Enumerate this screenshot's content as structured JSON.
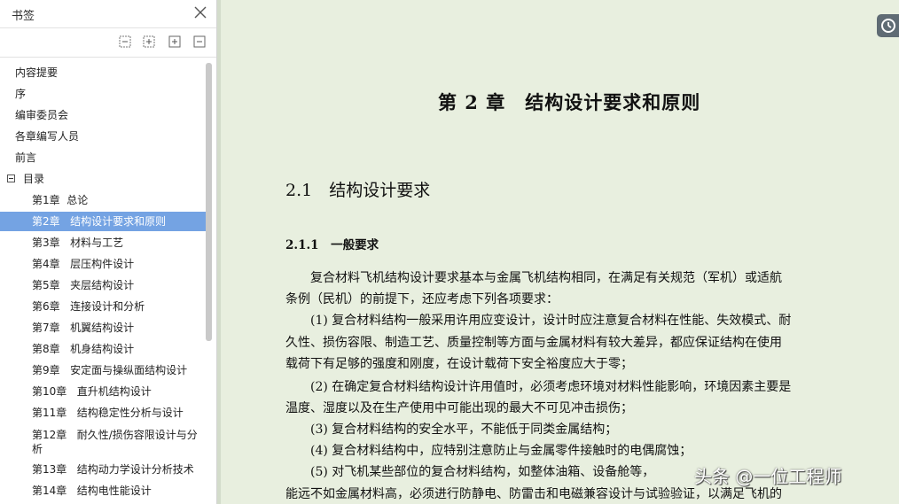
{
  "sidebar": {
    "title": "书签",
    "items": [
      {
        "label": "内容提要"
      },
      {
        "label": "序"
      },
      {
        "label": "编审委员会"
      },
      {
        "label": "各章编写人员"
      },
      {
        "label": "前言"
      },
      {
        "label": "目录"
      },
      {
        "num": "第1章",
        "label": "总论"
      },
      {
        "num": "第2章",
        "label": "结构设计要求和原则"
      },
      {
        "num": "第3章",
        "label": "材料与工艺"
      },
      {
        "num": "第4章",
        "label": "层压构件设计"
      },
      {
        "num": "第5章",
        "label": "夹层结构设计"
      },
      {
        "num": "第6章",
        "label": "连接设计和分析"
      },
      {
        "num": "第7章",
        "label": "机翼结构设计"
      },
      {
        "num": "第8章",
        "label": "机身结构设计"
      },
      {
        "num": "第9章",
        "label": "安定面与操纵面结构设计"
      },
      {
        "num": "第10章",
        "label": "直升机结构设计"
      },
      {
        "num": "第11章",
        "label": "结构稳定性分析与设计"
      },
      {
        "num": "第12章",
        "label": "耐久性/损伤容限设计与分析"
      },
      {
        "num": "第13章",
        "label": "结构动力学设计分析技术"
      },
      {
        "num": "第14章",
        "label": "结构电性能设计"
      }
    ],
    "selected_index": 7
  },
  "document": {
    "chapter_title": "第 2 章　结构设计要求和原则",
    "section_title": "2.1　结构设计要求",
    "subsection_title": "2.1.1　一般要求",
    "lines": [
      "　　复合材料飞机结构设计要求基本与金属飞机结构相同，在满足有关规范（军机）或适航",
      "条例（民机）的前提下，还应考虑下列各项要求：",
      "　　(1) 复合材料结构一般采用许用应变设计，设计时应注意复合材料在性能、失效模式、耐",
      "久性、损伤容限、制造工艺、质量控制等方面与金属材料有较大差异，都应保证结构在使用",
      "载荷下有足够的强度和刚度，在设计载荷下安全裕度应大于零；",
      "　　(2) 在确定复合材料结构设计许用值时，必须考虑环境对材料性能影响，环境因素主要是",
      "温度、湿度以及在生产使用中可能出现的最大不可见冲击损伤；",
      "　　(3) 复合材料结构的安全水平，不能低于同类金属结构；",
      "　　(4) 复合材料结构中，应特别注意防止与金属零件接触时的电偶腐蚀；",
      "　　(5) 对飞机某些部位的复合材料结构，如整体油箱、设备舱等，",
      "能远不如金属材料高，必须进行防静电、防雷击和电磁兼容设计与试验验证，以满足飞机的"
    ]
  },
  "watermark": "头条 @一位工程师",
  "colors": {
    "selection": "#74a3e3",
    "page_background": "#e8efdf"
  }
}
